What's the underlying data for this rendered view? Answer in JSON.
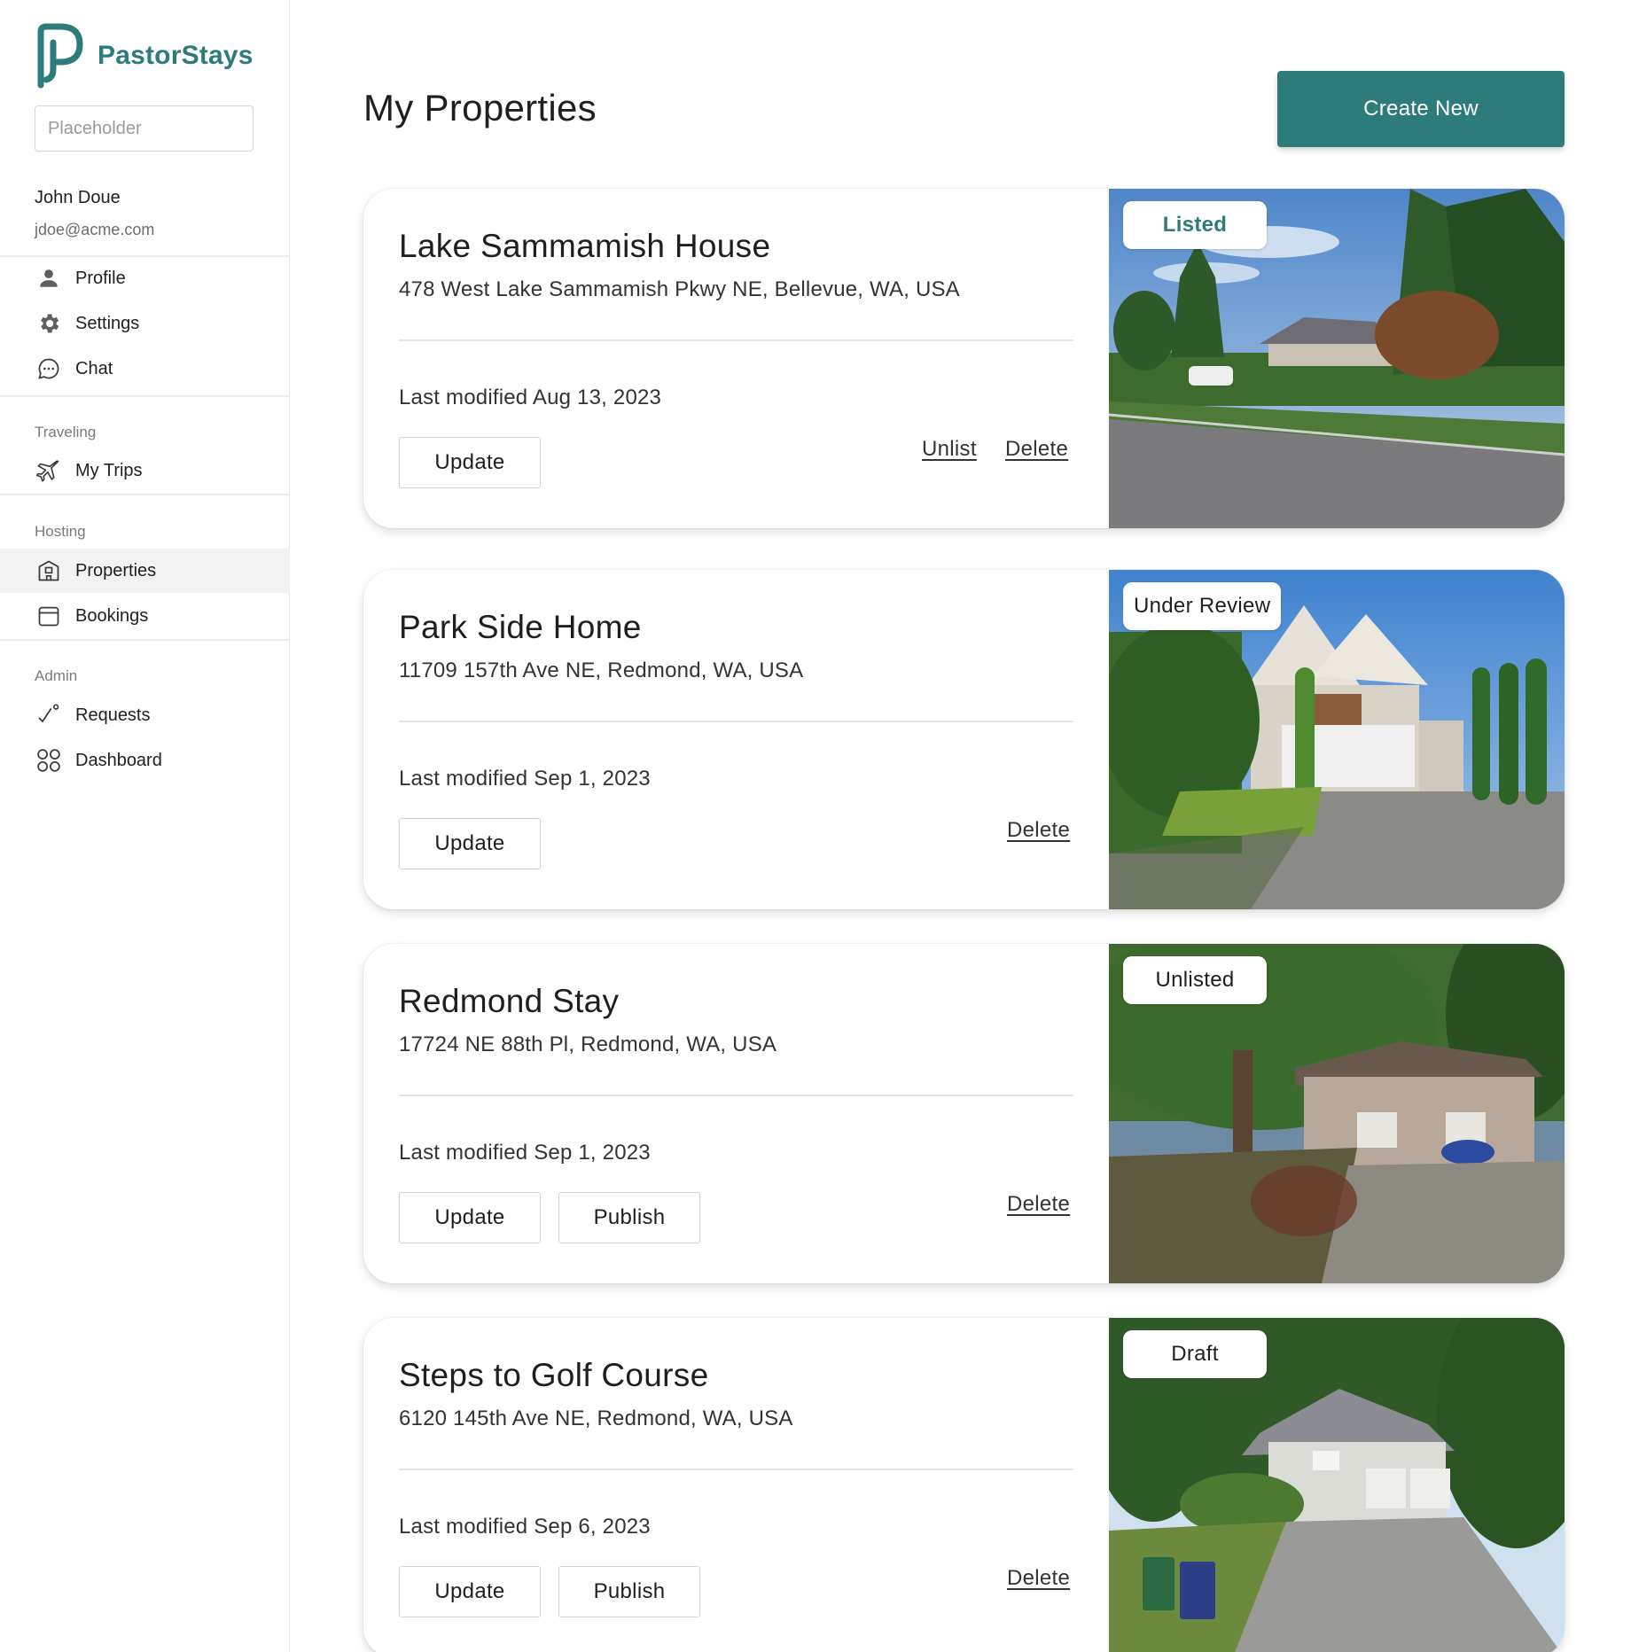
{
  "brand": {
    "name": "PastorStays",
    "color": "#2e7b7b",
    "logo_icon": "pastorstays-logo-icon"
  },
  "search": {
    "placeholder": "Placeholder",
    "value": ""
  },
  "user": {
    "name": "John Doue",
    "email": "jdoe@acme.com"
  },
  "nav": {
    "account": [
      {
        "label": "Profile",
        "icon": "person-icon"
      },
      {
        "label": "Settings",
        "icon": "gear-icon"
      },
      {
        "label": "Chat",
        "icon": "chat-bubble-icon"
      }
    ],
    "traveling": {
      "heading": "Traveling",
      "items": [
        {
          "label": "My Trips",
          "icon": "airplane-icon"
        }
      ]
    },
    "hosting": {
      "heading": "Hosting",
      "items": [
        {
          "label": "Properties",
          "icon": "building-icon",
          "active": true
        },
        {
          "label": "Bookings",
          "icon": "calendar-icon"
        }
      ]
    },
    "admin": {
      "heading": "Admin",
      "items": [
        {
          "label": "Requests",
          "icon": "check-trend-icon"
        },
        {
          "label": "Dashboard",
          "icon": "grid-circles-icon"
        }
      ]
    }
  },
  "page": {
    "title": "My Properties",
    "create_label": "Create New"
  },
  "properties": [
    {
      "title": "Lake Sammamish House",
      "address": "478 West Lake Sammamish Pkwy NE, Bellevue, WA, USA",
      "modified": "Last modified Aug 13, 2023",
      "status": "Listed",
      "update_label": "Update",
      "unlist_label": "Unlist",
      "delete_label": "Delete"
    },
    {
      "title": "Park Side Home",
      "address": "11709 157th Ave NE, Redmond, WA, USA",
      "modified": "Last modified Sep 1, 2023",
      "status": "Under Review",
      "update_label": "Update",
      "delete_label": "Delete"
    },
    {
      "title": "Redmond Stay",
      "address": "17724 NE 88th Pl, Redmond, WA, USA",
      "modified": "Last modified Sep 1, 2023",
      "status": "Unlisted",
      "update_label": "Update",
      "publish_label": "Publish",
      "delete_label": "Delete"
    },
    {
      "title": "Steps to Golf Course",
      "address": "6120 145th Ave NE, Redmond, WA, USA",
      "modified": "Last modified Sep 6, 2023",
      "status": "Draft",
      "update_label": "Update",
      "publish_label": "Publish",
      "delete_label": "Delete"
    }
  ]
}
